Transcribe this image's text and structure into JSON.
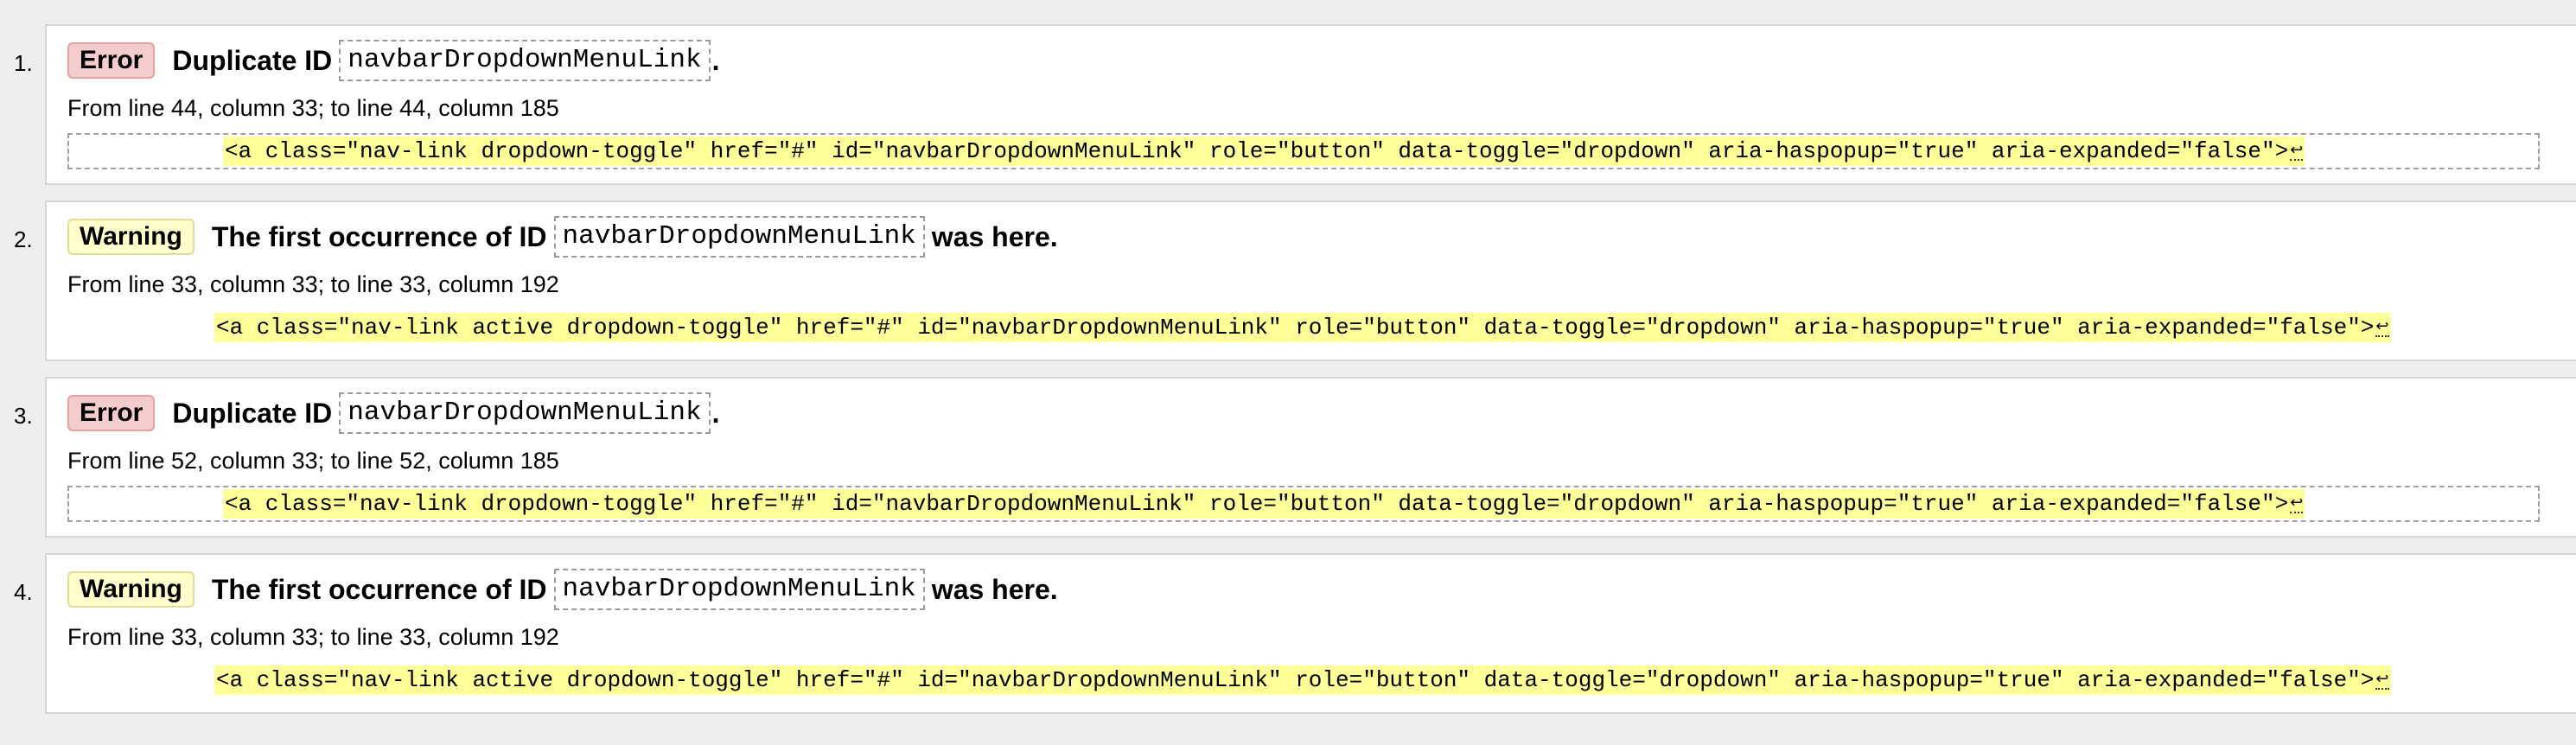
{
  "messages": [
    {
      "number": "1.",
      "type": "Error",
      "text_before": "Duplicate ID",
      "code": "navbarDropdownMenuLink",
      "text_after": ".",
      "location": "From line 44, column 33; to line 44, column 185",
      "extract": "<a class=\"nav-link dropdown-toggle\" href=\"#\" id=\"navbarDropdownMenuLink\" role=\"button\" data-toggle=\"dropdown\" aria-haspopup=\"true\" aria-expanded=\"false\">",
      "eol": "↩"
    },
    {
      "number": "2.",
      "type": "Warning",
      "text_before": "The first occurrence of ID",
      "code": "navbarDropdownMenuLink",
      "text_after": "was here.",
      "location": "From line 33, column 33; to line 33, column 192",
      "extract": "<a class=\"nav-link active dropdown-toggle\" href=\"#\" id=\"navbarDropdownMenuLink\" role=\"button\" data-toggle=\"dropdown\" aria-haspopup=\"true\" aria-expanded=\"false\">",
      "eol": "↩"
    },
    {
      "number": "3.",
      "type": "Error",
      "text_before": "Duplicate ID",
      "code": "navbarDropdownMenuLink",
      "text_after": ".",
      "location": "From line 52, column 33; to line 52, column 185",
      "extract": "<a class=\"nav-link dropdown-toggle\" href=\"#\" id=\"navbarDropdownMenuLink\" role=\"button\" data-toggle=\"dropdown\" aria-haspopup=\"true\" aria-expanded=\"false\">",
      "eol": "↩"
    },
    {
      "number": "4.",
      "type": "Warning",
      "text_before": "The first occurrence of ID",
      "code": "navbarDropdownMenuLink",
      "text_after": "was here.",
      "location": "From line 33, column 33; to line 33, column 192",
      "extract": "<a class=\"nav-link active dropdown-toggle\" href=\"#\" id=\"navbarDropdownMenuLink\" role=\"button\" data-toggle=\"dropdown\" aria-haspopup=\"true\" aria-expanded=\"false\">",
      "eol": "↩"
    }
  ],
  "colors": {
    "error_badge_bg": "#f4cccc",
    "warning_badge_bg": "#ffffcc",
    "highlight": "#ffff99",
    "page_bg": "#eeeeee"
  }
}
